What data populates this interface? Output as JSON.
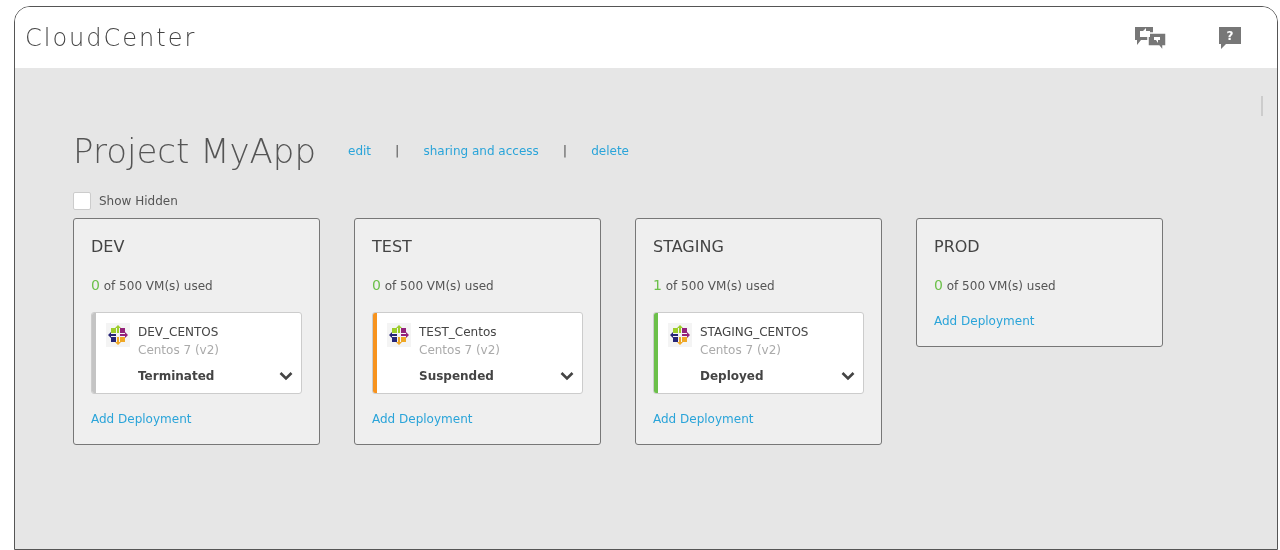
{
  "app": {
    "title": "CloudCenter",
    "help_label": "?"
  },
  "project": {
    "title": "Project MyApp",
    "links": [
      "edit",
      "sharing and access",
      "delete"
    ],
    "separators": [
      "|",
      "|"
    ]
  },
  "show_hidden": {
    "label": "Show Hidden",
    "checked": false
  },
  "environments": [
    {
      "name": "DEV",
      "used_count": "0",
      "usage_text": "of 500 VM(s) used",
      "deployments": [
        {
          "name": "DEV_CENTOS",
          "subtitle": "Centos 7 (v2)",
          "status": "Terminated",
          "color": "#c4c4c4"
        }
      ],
      "add_link": "Add Deployment"
    },
    {
      "name": "TEST",
      "used_count": "0",
      "usage_text": "of 500 VM(s) used",
      "deployments": [
        {
          "name": "TEST_Centos",
          "subtitle": "Centos 7 (v2)",
          "status": "Suspended",
          "color": "#f7931e"
        }
      ],
      "add_link": "Add Deployment"
    },
    {
      "name": "STAGING",
      "used_count": "1",
      "usage_text": "of 500 VM(s) used",
      "deployments": [
        {
          "name": "STAGING_CENTOS",
          "subtitle": "Centos 7 (v2)",
          "status": "Deployed",
          "color": "#6cc04a"
        }
      ],
      "add_link": "Add Deployment"
    },
    {
      "name": "PROD",
      "used_count": "0",
      "usage_text": "of 500 VM(s) used",
      "add_link": "Add Deployment"
    }
  ]
}
